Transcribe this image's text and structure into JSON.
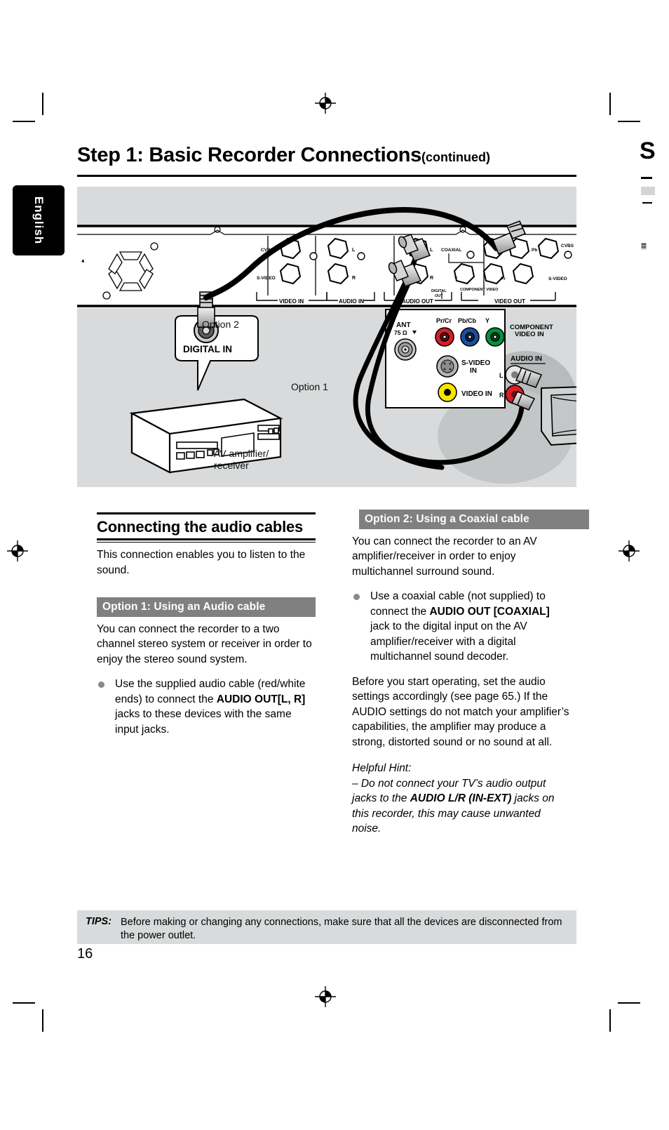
{
  "page": {
    "language_tab": "English",
    "number": "16",
    "title_main": "Step 1: Basic Recorder Connections",
    "title_continued": "(continued)",
    "next_page_bleed": "S"
  },
  "diagram": {
    "label_option2": "Option 2",
    "label_option1": "Option 1",
    "label_digital_in": "DIGITAL IN",
    "label_av_amp_line1": "AV amplifier/",
    "label_av_amp_line2": "receiver",
    "recorder_panel": {
      "video_in_group": "VIDEO IN",
      "audio_in_group": "AUDIO IN",
      "audio_out_group": "AUDIO OUT",
      "video_out_group": "VIDEO OUT",
      "cvbs_in": "CVBS",
      "svideo_in": "S-VIDEO",
      "audio_in_l": "L",
      "audio_in_r": "R",
      "audio_out_l": "L",
      "audio_out_r": "R",
      "coaxial": "COAXIAL",
      "digital_out_line1": "DIGITAL",
      "digital_out_line2": "OUT",
      "component_video": "COMPONENT VIDEO",
      "comp_y": "Y",
      "comp_pb": "Pb",
      "comp_pr": "Pr",
      "cvbs_out": "CVBS",
      "svideo_out": "S-VIDEO"
    },
    "tv_panel": {
      "ant": "ANT",
      "ant_ohm": "75 Ω",
      "pr_cr": "Pr/Cr",
      "pb_cb": "Pb/Cb",
      "y": "Y",
      "component_video_in_line1": "COMPONENT",
      "component_video_in_line2": "VIDEO IN",
      "svideo_in_line1": "S-VIDEO",
      "svideo_in_line2": "IN",
      "video_in": "VIDEO IN",
      "audio_in": "AUDIO IN",
      "audio_l": "L",
      "audio_r": "R"
    },
    "colors": {
      "background": "#d8dadb",
      "red": "#d81f26",
      "blue": "#1b4fa0",
      "green": "#00923f",
      "yellow": "#f6e400",
      "connector_gray": "#b3b3b3"
    }
  },
  "left_column": {
    "heading": "Connecting the audio cables",
    "intro": "This connection enables you to listen to the sound.",
    "option1_bar": "Option 1: Using an Audio cable",
    "option1_para": "You can connect the recorder to a two channel stereo system or receiver in order to enjoy the stereo sound system.",
    "option1_bullet_pre": "Use the supplied audio cable (red/white ends) to connect the ",
    "option1_bullet_bold": "AUDIO OUT[L, R]",
    "option1_bullet_post": " jacks to these devices with the same input jacks."
  },
  "right_column": {
    "option2_bar": "Option 2: Using a Coaxial cable",
    "option2_para": "You can connect the recorder to an AV amplifier/receiver in order to enjoy multichannel surround sound.",
    "option2_bullet_pre": "Use a coaxial cable (not supplied) to connect the ",
    "option2_bullet_bold": "AUDIO OUT [COAXIAL]",
    "option2_bullet_post": " jack to the digital input on the AV amplifier/receiver with a digital multichannel sound decoder.",
    "option2_note": "Before you start operating, set the audio settings accordingly (see page 65.) If the AUDIO settings do not match your amplifier’s capabilities, the amplifier may produce a strong, distorted sound or no sound at all.",
    "hint_title": "Helpful Hint:",
    "hint_pre": "– Do not connect your TV’s audio output jacks to the ",
    "hint_bold": "AUDIO L/R (IN-EXT)",
    "hint_post": " jacks on this recorder, this may cause unwanted noise."
  },
  "tips": {
    "label": "TIPS:",
    "text": "Before making or changing any connections, make sure that all the devices are disconnected from the power outlet."
  }
}
